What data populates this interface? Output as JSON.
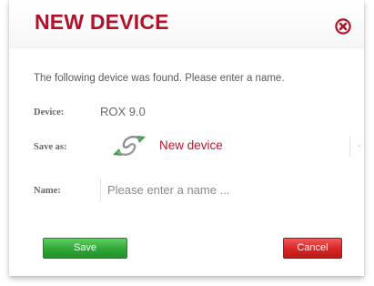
{
  "colors": {
    "title": "#b0122b",
    "accent_red": "#c8102e",
    "save_green": "#32a83a",
    "cancel_red": "#d62a2a"
  },
  "dialog": {
    "title": "NEW DEVICE",
    "close_icon": "close-circle-x-icon",
    "intro": "The following device was found. Please enter a name."
  },
  "device": {
    "label": "Device:",
    "value": "ROX 9.0"
  },
  "save_as": {
    "label": "Save as:",
    "icon": "sync-arrows-icon",
    "value": "New device",
    "trailing": "-"
  },
  "name": {
    "label": "Name:",
    "placeholder": "Please enter a name ..."
  },
  "buttons": {
    "save": "Save",
    "cancel": "Cancel"
  }
}
